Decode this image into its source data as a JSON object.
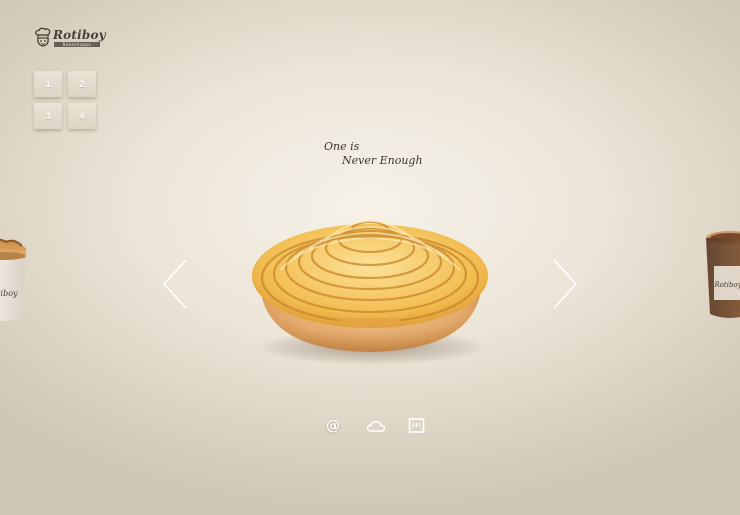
{
  "brand": {
    "name": "Rotiboy",
    "subtitle": "Bakeshoppe"
  },
  "pager": {
    "items": [
      "1",
      "2",
      "3",
      "4"
    ]
  },
  "tagline": {
    "line1": "One is",
    "line2": "Never Enough"
  },
  "icons": {
    "at": "@",
    "cloud": "cloud-icon",
    "social": "social-icon",
    "prev": "chevron-left-icon",
    "next": "chevron-right-icon"
  },
  "colors": {
    "background": "#ece5d8",
    "bun": "#f0b94c",
    "bun_base": "#e0a467",
    "text": "#3e3631"
  }
}
